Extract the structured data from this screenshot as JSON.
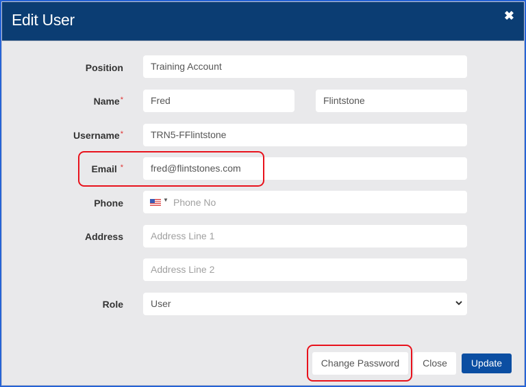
{
  "modal": {
    "title": "Edit User",
    "close_icon": "close-icon"
  },
  "form": {
    "position": {
      "label": "Position",
      "value": "Training Account"
    },
    "name": {
      "label": "Name",
      "required_mark": "*",
      "first_value": "Fred",
      "last_value": "Flintstone"
    },
    "username": {
      "label": "Username",
      "required_mark": "*",
      "value": "TRN5-FFlintstone"
    },
    "email": {
      "label": "Email",
      "required_mark": "*",
      "value": "fred@flintstones.com"
    },
    "phone": {
      "label": "Phone",
      "country_flag": "us-flag-icon",
      "placeholder": "Phone No",
      "value": ""
    },
    "address": {
      "label": "Address",
      "line1_placeholder": "Address Line 1",
      "line2_placeholder": "Address Line 2",
      "line1_value": "",
      "line2_value": ""
    },
    "role": {
      "label": "Role",
      "selected": "User"
    }
  },
  "footer": {
    "change_password_label": "Change Password",
    "close_label": "Close",
    "update_label": "Update"
  },
  "colors": {
    "header_bg": "#0b3d73",
    "primary_button": "#0b4ea2",
    "highlight": "#e8101a",
    "required": "#e03030"
  }
}
